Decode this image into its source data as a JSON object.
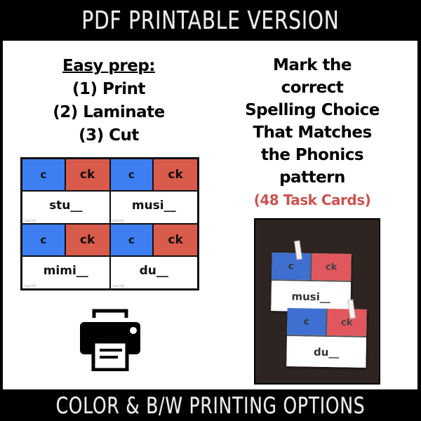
{
  "header": {
    "title": "PDF PRINTABLE VERSION"
  },
  "footer": {
    "title": "COLOR & B/W PRINTING OPTIONS"
  },
  "prep": {
    "title": "Easy prep:",
    "steps": [
      "(1) Print",
      "(2) Laminate",
      "(3) Cut"
    ]
  },
  "instructions": {
    "lines": [
      "Mark the",
      "correct",
      "Spelling Choice",
      "That Matches",
      "the Phonics",
      "pattern"
    ],
    "count": "(48 Task Cards)",
    "count_color": "#c9524f"
  },
  "colors": {
    "choice_c": "#3d7ef2",
    "choice_ck": "#d95b4b"
  },
  "cards": [
    {
      "option_a": "c",
      "option_b": "ck",
      "word": "stu__",
      "number": "Card #1"
    },
    {
      "option_a": "c",
      "option_b": "ck",
      "word": "musi__",
      "number": "Card #2"
    },
    {
      "option_a": "c",
      "option_b": "ck",
      "word": "mimi__",
      "number": "Card #3"
    },
    {
      "option_a": "c",
      "option_b": "ck",
      "word": "du__",
      "number": "Card #4"
    }
  ],
  "printer_icon": "printer-icon",
  "photo": {
    "cards": [
      {
        "option_a": "c",
        "option_b": "ck",
        "word": "musi__"
      },
      {
        "option_a": "c",
        "option_b": "ck",
        "word": "du__"
      }
    ]
  }
}
